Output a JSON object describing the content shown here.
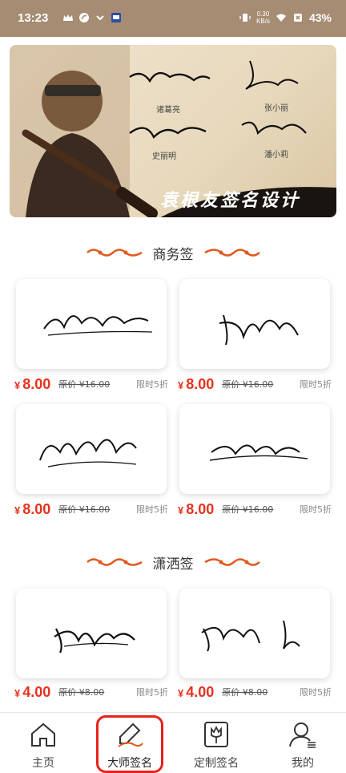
{
  "status_bar": {
    "time": "13:23",
    "net_speed_value": "0.30",
    "net_speed_unit": "KB/s",
    "battery": "43%"
  },
  "banner": {
    "slogan": "袁根友签名设计",
    "captions": [
      "诸葛亮",
      "张小丽",
      "史丽明",
      "潘小莉"
    ]
  },
  "sections": [
    {
      "title": "商务签",
      "items": [
        {
          "price": "8.00",
          "original": "原价 ¥16.00",
          "discount": "限时5折"
        },
        {
          "price": "8.00",
          "original": "原价 ¥16.00",
          "discount": "限时5折"
        },
        {
          "price": "8.00",
          "original": "原价 ¥16.00",
          "discount": "限时5折"
        },
        {
          "price": "8.00",
          "original": "原价 ¥16.00",
          "discount": "限时5折"
        }
      ]
    },
    {
      "title": "潇洒签",
      "items": [
        {
          "price": "4.00",
          "original": "原价 ¥8.00",
          "discount": "限时5折"
        },
        {
          "price": "4.00",
          "original": "原价 ¥8.00",
          "discount": "限时5折"
        }
      ]
    }
  ],
  "currency_symbol": "¥",
  "tabbar": {
    "tabs": [
      {
        "label": "主页",
        "icon": "home-icon"
      },
      {
        "label": "大师签名",
        "icon": "brush-pen-icon"
      },
      {
        "label": "定制签名",
        "icon": "tulip-icon"
      },
      {
        "label": "我的",
        "icon": "user-icon"
      }
    ],
    "active_index": 1
  },
  "colors": {
    "status_bar": "#a58c73",
    "price_red": "#e8321f",
    "ornament": "#e05a1e",
    "active_ring": "#e8221a"
  }
}
